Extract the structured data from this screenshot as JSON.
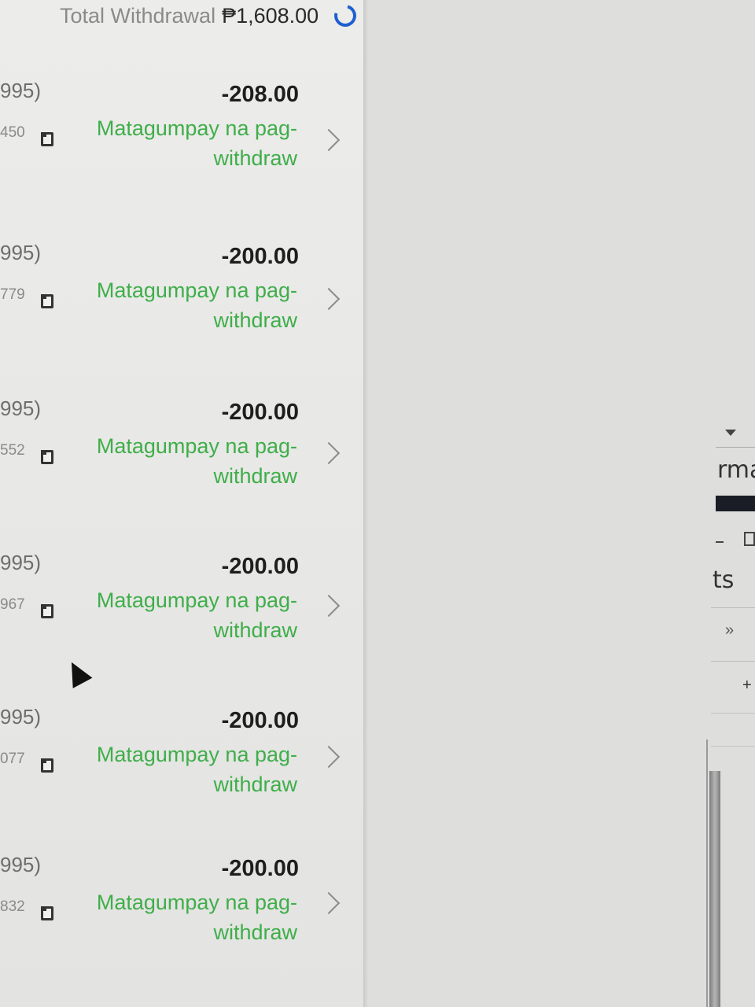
{
  "header": {
    "total_label": "Total Withdrawal",
    "total_amount": "₱1,608.00",
    "refresh_icon": "refresh-icon"
  },
  "transactions": [
    {
      "account": "995)",
      "amount": "-208.00",
      "reference": "450",
      "status": "Matagumpay na pag-withdraw"
    },
    {
      "account": "995)",
      "amount": "-200.00",
      "reference": "779",
      "status": "Matagumpay na pag-withdraw"
    },
    {
      "account": "995)",
      "amount": "-200.00",
      "reference": "552",
      "status": "Matagumpay na pag-withdraw"
    },
    {
      "account": "995)",
      "amount": "-200.00",
      "reference": "967",
      "status": "Matagumpay na pag-withdraw"
    },
    {
      "account": "995)",
      "amount": "-200.00",
      "reference": "077",
      "status": "Matagumpay na pag-withdraw"
    },
    {
      "account": "995)",
      "amount": "-200.00",
      "reference": "832",
      "status": "Matagumpay na pag-withdraw"
    }
  ],
  "side_window": {
    "text_1": "rma",
    "text_2": "ts",
    "more": "»",
    "plus": "+"
  },
  "colors": {
    "status_success": "#3fae4a",
    "refresh_icon": "#1f5fd0"
  }
}
